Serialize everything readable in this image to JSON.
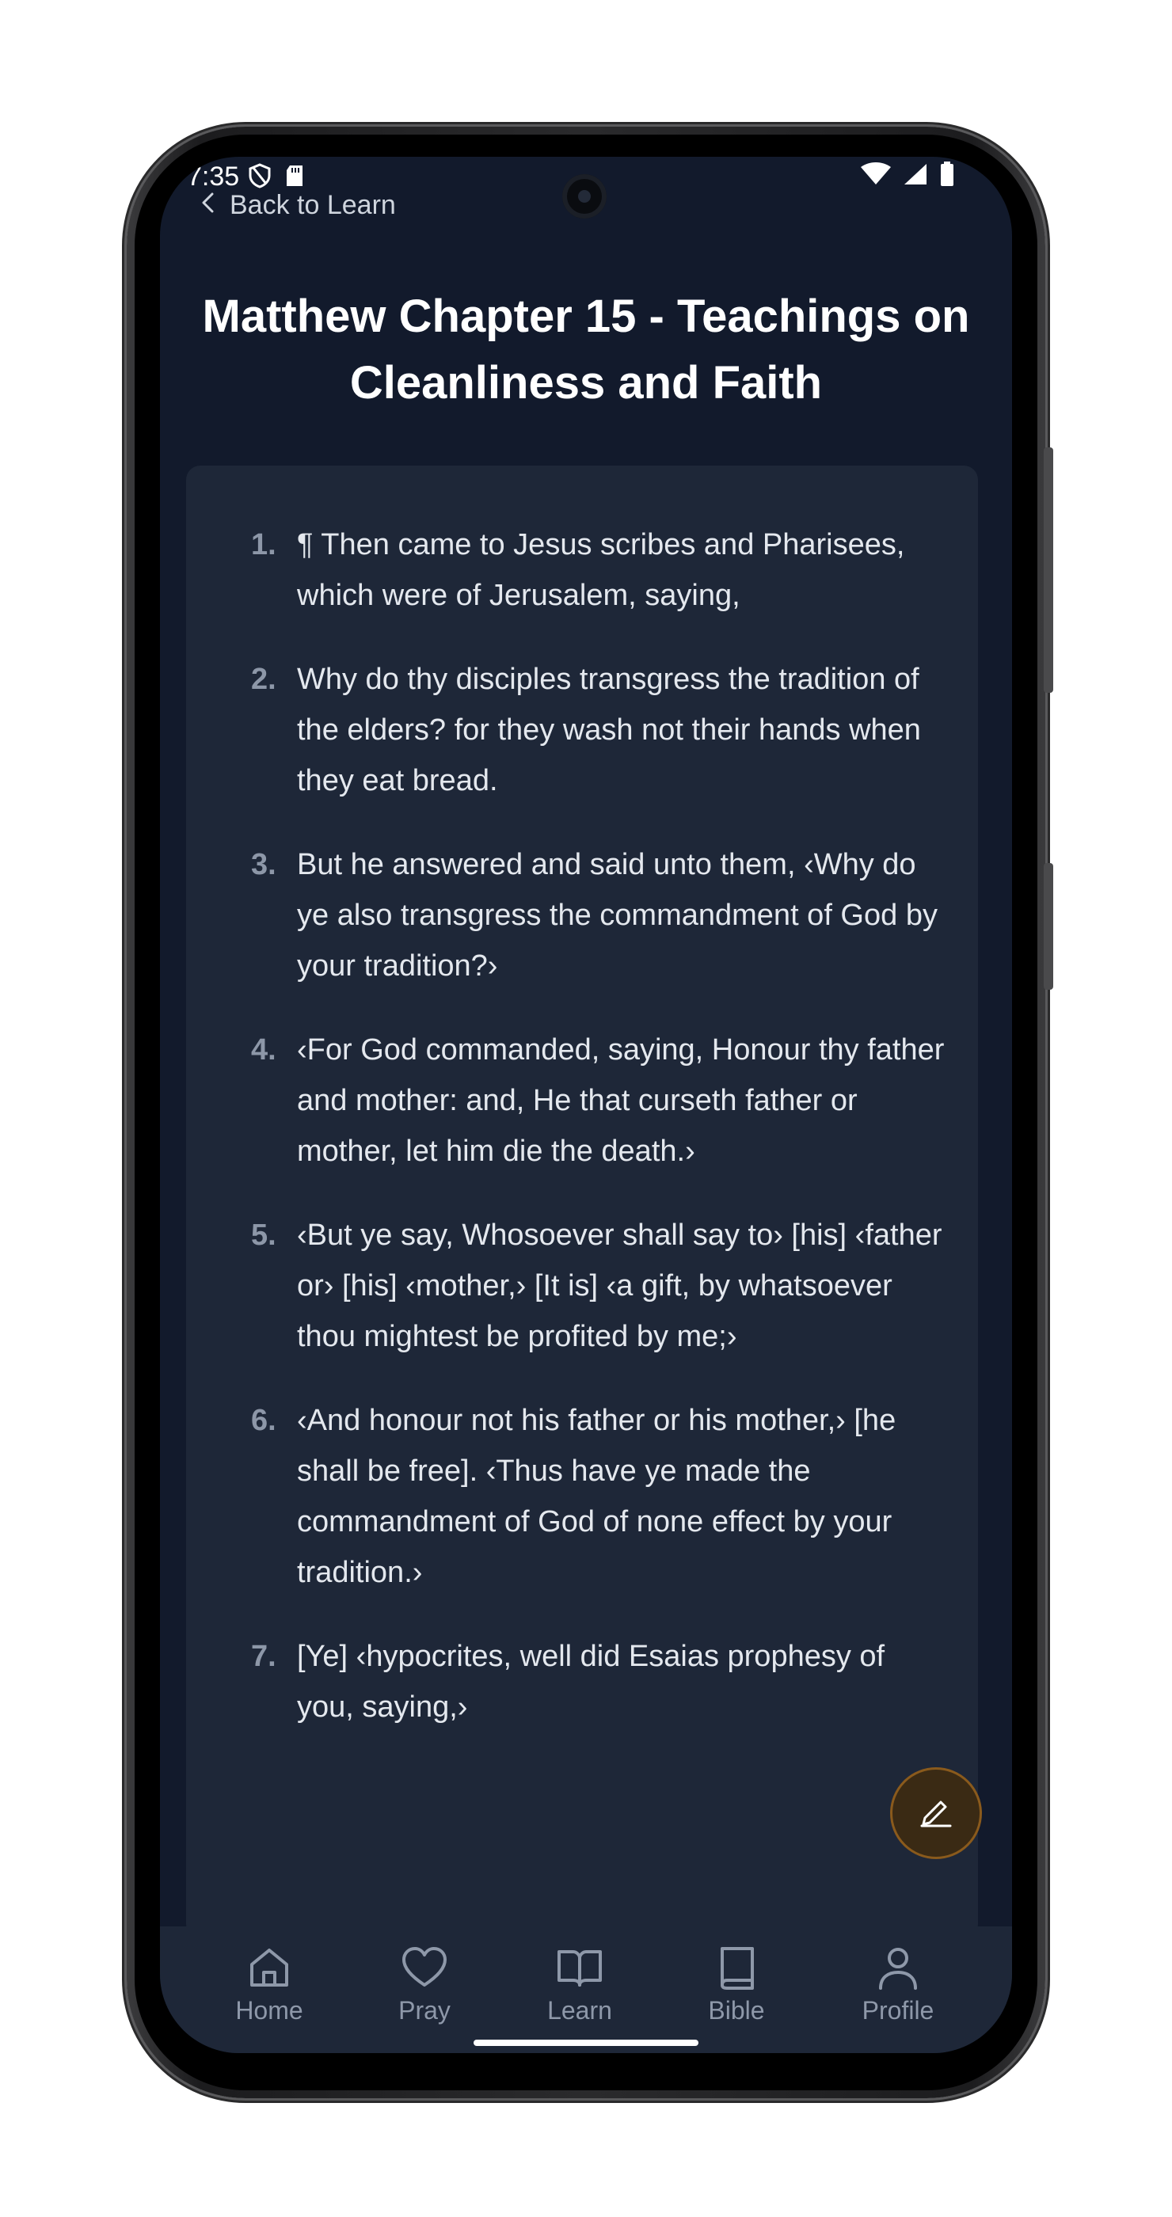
{
  "status_bar": {
    "time": "7:35"
  },
  "header": {
    "back_label": "Back to Learn",
    "title": "Matthew Chapter 15 - Teachings on Cleanliness and Faith"
  },
  "verses": [
    {
      "num": "1.",
      "text": "¶ Then came to Jesus scribes and Pharisees, which were of Jerusalem, saying,"
    },
    {
      "num": "2.",
      "text": "Why do thy disciples transgress the tradition of the elders? for they wash not their hands when they eat bread."
    },
    {
      "num": "3.",
      "text": "But he answered and said unto them, ‹Why do ye also transgress the commandment of God by your tradition?›"
    },
    {
      "num": "4.",
      "text": "‹For God commanded, saying, Honour thy father and mother: and, He that curseth father or mother, let him die the death.›"
    },
    {
      "num": "5.",
      "text": "‹But ye say, Whosoever shall say to› [his] ‹father or› [his] ‹mother,› [It is] ‹a gift, by whatsoever thou mightest be profited by me;›"
    },
    {
      "num": "6.",
      "text": "‹And honour not his father or his mother,› [he shall be free]. ‹Thus have ye made the commandment of God of none effect by your tradition.›"
    },
    {
      "num": "7.",
      "text": "[Ye] ‹hypocrites, well did Esaias prophesy of you, saying,›"
    }
  ],
  "bottom_nav": {
    "items": [
      {
        "label": "Home",
        "icon": "home-icon"
      },
      {
        "label": "Pray",
        "icon": "heart-icon"
      },
      {
        "label": "Learn",
        "icon": "open-book-icon",
        "active": true
      },
      {
        "label": "Bible",
        "icon": "book-icon"
      },
      {
        "label": "Profile",
        "icon": "person-icon"
      }
    ]
  },
  "colors": {
    "background": "#121a2c",
    "card": "#1e2738",
    "text": "#e4e8ee",
    "muted": "#8e98a9",
    "fab_accent": "#8a5a1c"
  }
}
